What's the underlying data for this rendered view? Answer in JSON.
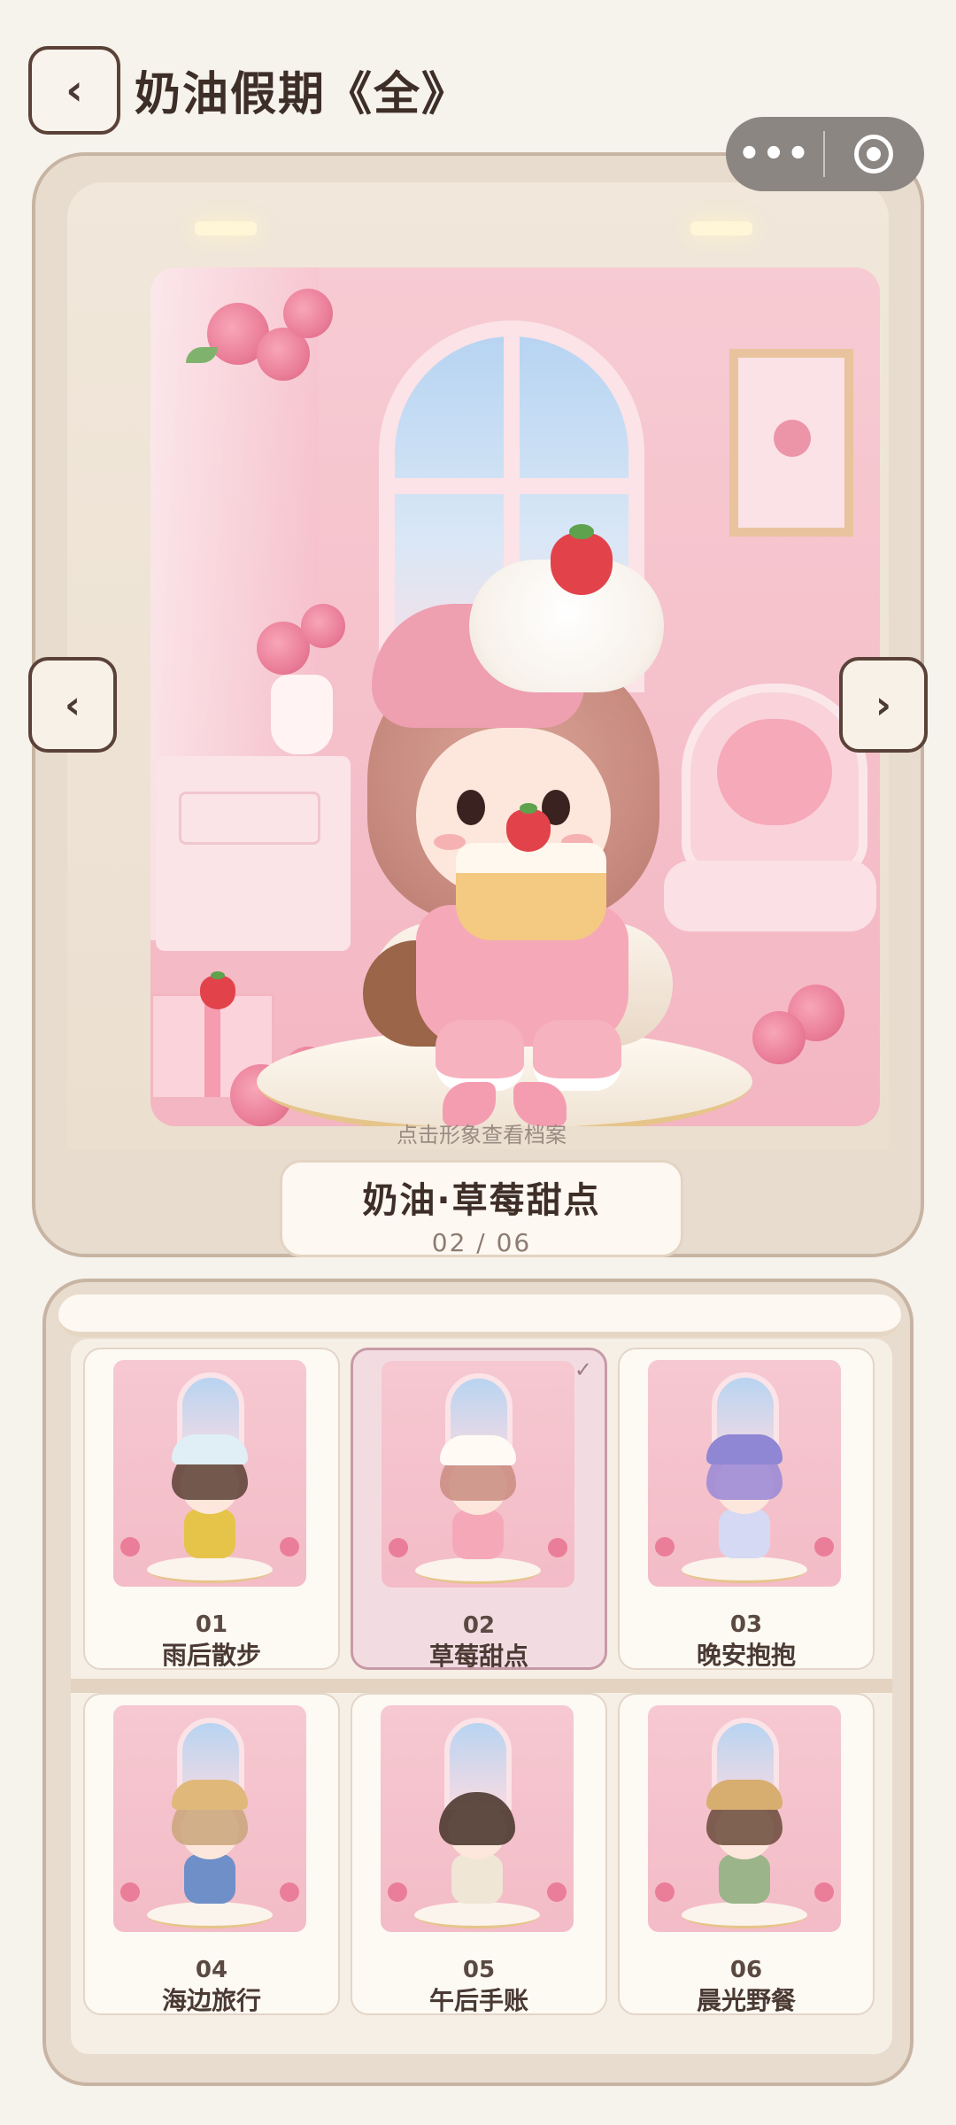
{
  "header": {
    "back_label": "‹",
    "title": "奶油假期《全》",
    "capsule_more": "•••"
  },
  "showcase": {
    "hint": "点击形象查看档案",
    "current_name": "奶油·草莓甜点",
    "current_index": "02 / 06",
    "prev_label": "‹",
    "next_label": "›"
  },
  "grid": {
    "selected_mark": "✓",
    "items": [
      {
        "num": "01",
        "label": "雨后散步"
      },
      {
        "num": "02",
        "label": "草莓甜点"
      },
      {
        "num": "03",
        "label": "晚安抱抱"
      },
      {
        "num": "04",
        "label": "海边旅行"
      },
      {
        "num": "05",
        "label": "午后手账"
      },
      {
        "num": "06",
        "label": "晨光野餐"
      }
    ]
  },
  "colors": {
    "accent": "#c79aa7",
    "card_bg": "#fdf9f3",
    "selected_bg": "#f2dce2",
    "frame": "#e8dccf"
  },
  "icons": [
    "back-icon",
    "more-icon",
    "target-icon",
    "chevron-left-icon",
    "chevron-right-icon",
    "check-icon"
  ]
}
